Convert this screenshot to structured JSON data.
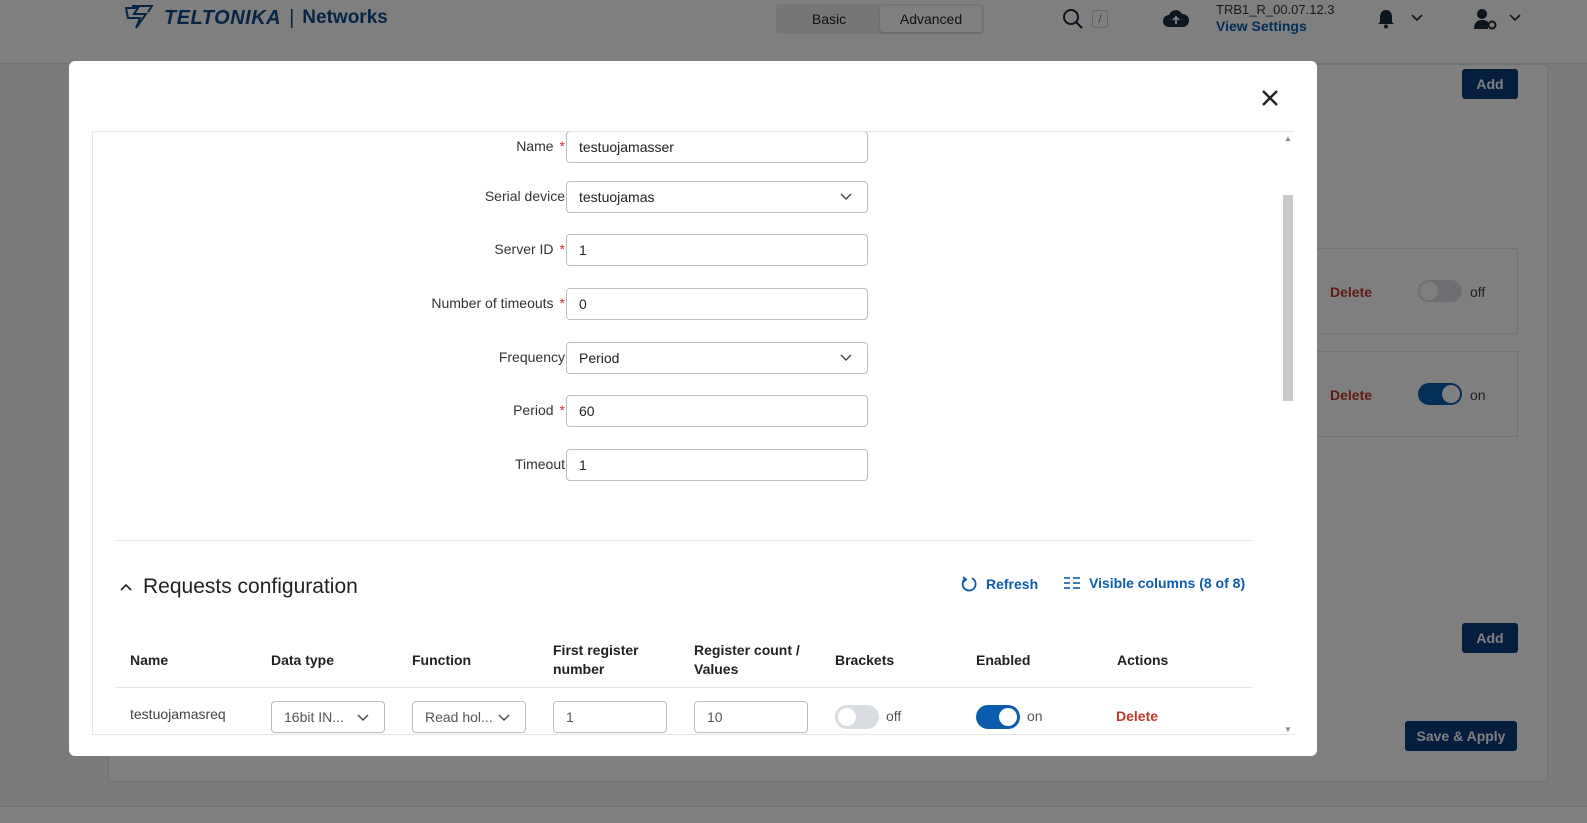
{
  "header": {
    "brand": "TELTONIKA",
    "separator": "|",
    "brand_sub": "Networks",
    "mode_basic": "Basic",
    "mode_advanced": "Advanced",
    "search_shortcut": "/",
    "firmware": "TRB1_R_00.07.12.3",
    "view_settings": "View Settings"
  },
  "background": {
    "add_label": "Add",
    "delete_label": "Delete",
    "toggle_off": "off",
    "toggle_on": "on",
    "save_apply": "Save & Apply"
  },
  "form": {
    "name": {
      "label": "Name",
      "required": "*",
      "value": "testuojamasser"
    },
    "serial_device": {
      "label": "Serial device",
      "value": "testuojamas"
    },
    "server_id": {
      "label": "Server ID",
      "required": "*",
      "value": "1"
    },
    "timeouts": {
      "label": "Number of timeouts",
      "required": "*",
      "value": "0"
    },
    "frequency": {
      "label": "Frequency",
      "value": "Period"
    },
    "period": {
      "label": "Period",
      "required": "*",
      "value": "60"
    },
    "timeout": {
      "label": "Timeout",
      "value": "1"
    }
  },
  "requests": {
    "title": "Requests configuration",
    "refresh": "Refresh",
    "visible_columns": "Visible columns (8 of 8)",
    "columns": {
      "name": "Name",
      "data_type": "Data type",
      "function": "Function",
      "first_register_a": "First register",
      "first_register_b": "number",
      "register_count_a": "Register count /",
      "register_count_b": "Values",
      "brackets": "Brackets",
      "enabled": "Enabled",
      "actions": "Actions"
    },
    "row": {
      "name": "testuojamasreq",
      "data_type": "16bit IN...",
      "function": "Read hol...",
      "first_register": "1",
      "register_count": "10",
      "brackets": "off",
      "enabled": "on",
      "action": "Delete"
    }
  },
  "colors": {
    "primary": "#0a3d7a",
    "link": "#0b5cad",
    "danger": "#c0392b",
    "toggle_on": "#0b5cad",
    "toggle_off": "#d9dde2"
  }
}
